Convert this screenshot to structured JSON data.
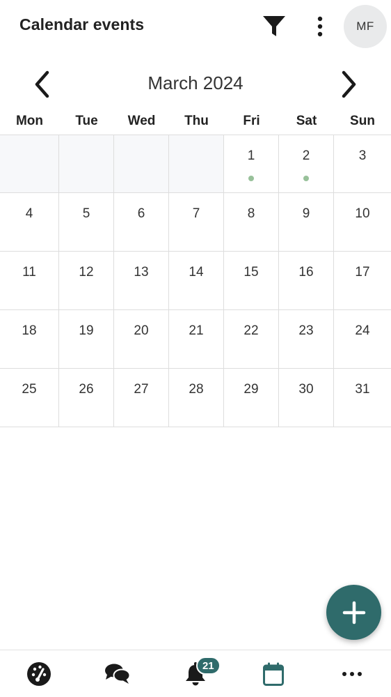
{
  "header": {
    "title": "Calendar events",
    "avatar_initials": "MF",
    "filter_icon": "filter-icon",
    "more_icon": "more-vertical-icon"
  },
  "calendar": {
    "month_label": "March 2024",
    "weekdays": [
      "Mon",
      "Tue",
      "Wed",
      "Thu",
      "Fri",
      "Sat",
      "Sun"
    ],
    "weeks": [
      [
        {
          "day": "",
          "empty": true,
          "event": false
        },
        {
          "day": "",
          "empty": true,
          "event": false
        },
        {
          "day": "",
          "empty": true,
          "event": false
        },
        {
          "day": "",
          "empty": true,
          "event": false
        },
        {
          "day": "1",
          "empty": false,
          "event": true
        },
        {
          "day": "2",
          "empty": false,
          "event": true
        },
        {
          "day": "3",
          "empty": false,
          "event": false
        }
      ],
      [
        {
          "day": "4",
          "empty": false,
          "event": false
        },
        {
          "day": "5",
          "empty": false,
          "event": false
        },
        {
          "day": "6",
          "empty": false,
          "event": false
        },
        {
          "day": "7",
          "empty": false,
          "event": false
        },
        {
          "day": "8",
          "empty": false,
          "event": false
        },
        {
          "day": "9",
          "empty": false,
          "event": false
        },
        {
          "day": "10",
          "empty": false,
          "event": false
        }
      ],
      [
        {
          "day": "11",
          "empty": false,
          "event": false
        },
        {
          "day": "12",
          "empty": false,
          "event": false
        },
        {
          "day": "13",
          "empty": false,
          "event": false
        },
        {
          "day": "14",
          "empty": false,
          "event": false
        },
        {
          "day": "15",
          "empty": false,
          "event": false
        },
        {
          "day": "16",
          "empty": false,
          "event": false
        },
        {
          "day": "17",
          "empty": false,
          "event": false
        }
      ],
      [
        {
          "day": "18",
          "empty": false,
          "event": false
        },
        {
          "day": "19",
          "empty": false,
          "event": false
        },
        {
          "day": "20",
          "empty": false,
          "event": false
        },
        {
          "day": "21",
          "empty": false,
          "event": false
        },
        {
          "day": "22",
          "empty": false,
          "event": false
        },
        {
          "day": "23",
          "empty": false,
          "event": false
        },
        {
          "day": "24",
          "empty": false,
          "event": false
        }
      ],
      [
        {
          "day": "25",
          "empty": false,
          "event": false
        },
        {
          "day": "26",
          "empty": false,
          "event": false
        },
        {
          "day": "27",
          "empty": false,
          "event": false
        },
        {
          "day": "28",
          "empty": false,
          "event": false
        },
        {
          "day": "29",
          "empty": false,
          "event": false
        },
        {
          "day": "30",
          "empty": false,
          "event": false
        },
        {
          "day": "31",
          "empty": false,
          "event": false
        }
      ]
    ]
  },
  "fab": {
    "icon": "plus-icon"
  },
  "bottom_nav": {
    "items": [
      {
        "icon": "dashboard-gauge-icon"
      },
      {
        "icon": "chat-bubbles-icon"
      },
      {
        "icon": "bell-icon",
        "badge": "21"
      },
      {
        "icon": "calendar-icon",
        "active": true
      },
      {
        "icon": "more-horizontal-icon"
      }
    ]
  },
  "colors": {
    "accent": "#2f6b6b",
    "event_dot": "#98c19a",
    "empty_cell": "#f7f8fa",
    "grid_line": "#dddddd",
    "avatar_bg": "#e9eaeb"
  }
}
